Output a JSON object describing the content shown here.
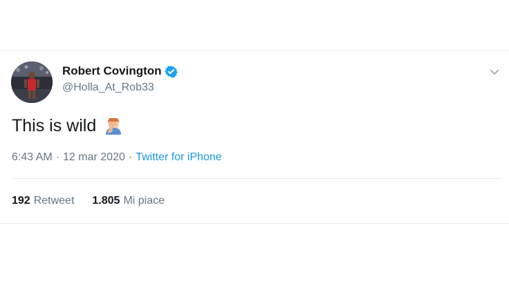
{
  "tweet": {
    "display_name": "Robert Covington",
    "handle": "@Holla_At_Rob33",
    "text": "This is wild",
    "emoji_icon": "facepalm-emoji-icon",
    "time": "6:43 AM",
    "date": "12 mar 2020",
    "separator": "·",
    "source": "Twitter for iPhone",
    "retweets_count": "192",
    "retweets_label": "Retweet",
    "likes_count": "1.805",
    "likes_label": "Mi piace"
  },
  "colors": {
    "accent": "#1b95e0",
    "verified": "#1da1f2",
    "secondary_text": "#657786",
    "border": "#e6ecf0"
  }
}
